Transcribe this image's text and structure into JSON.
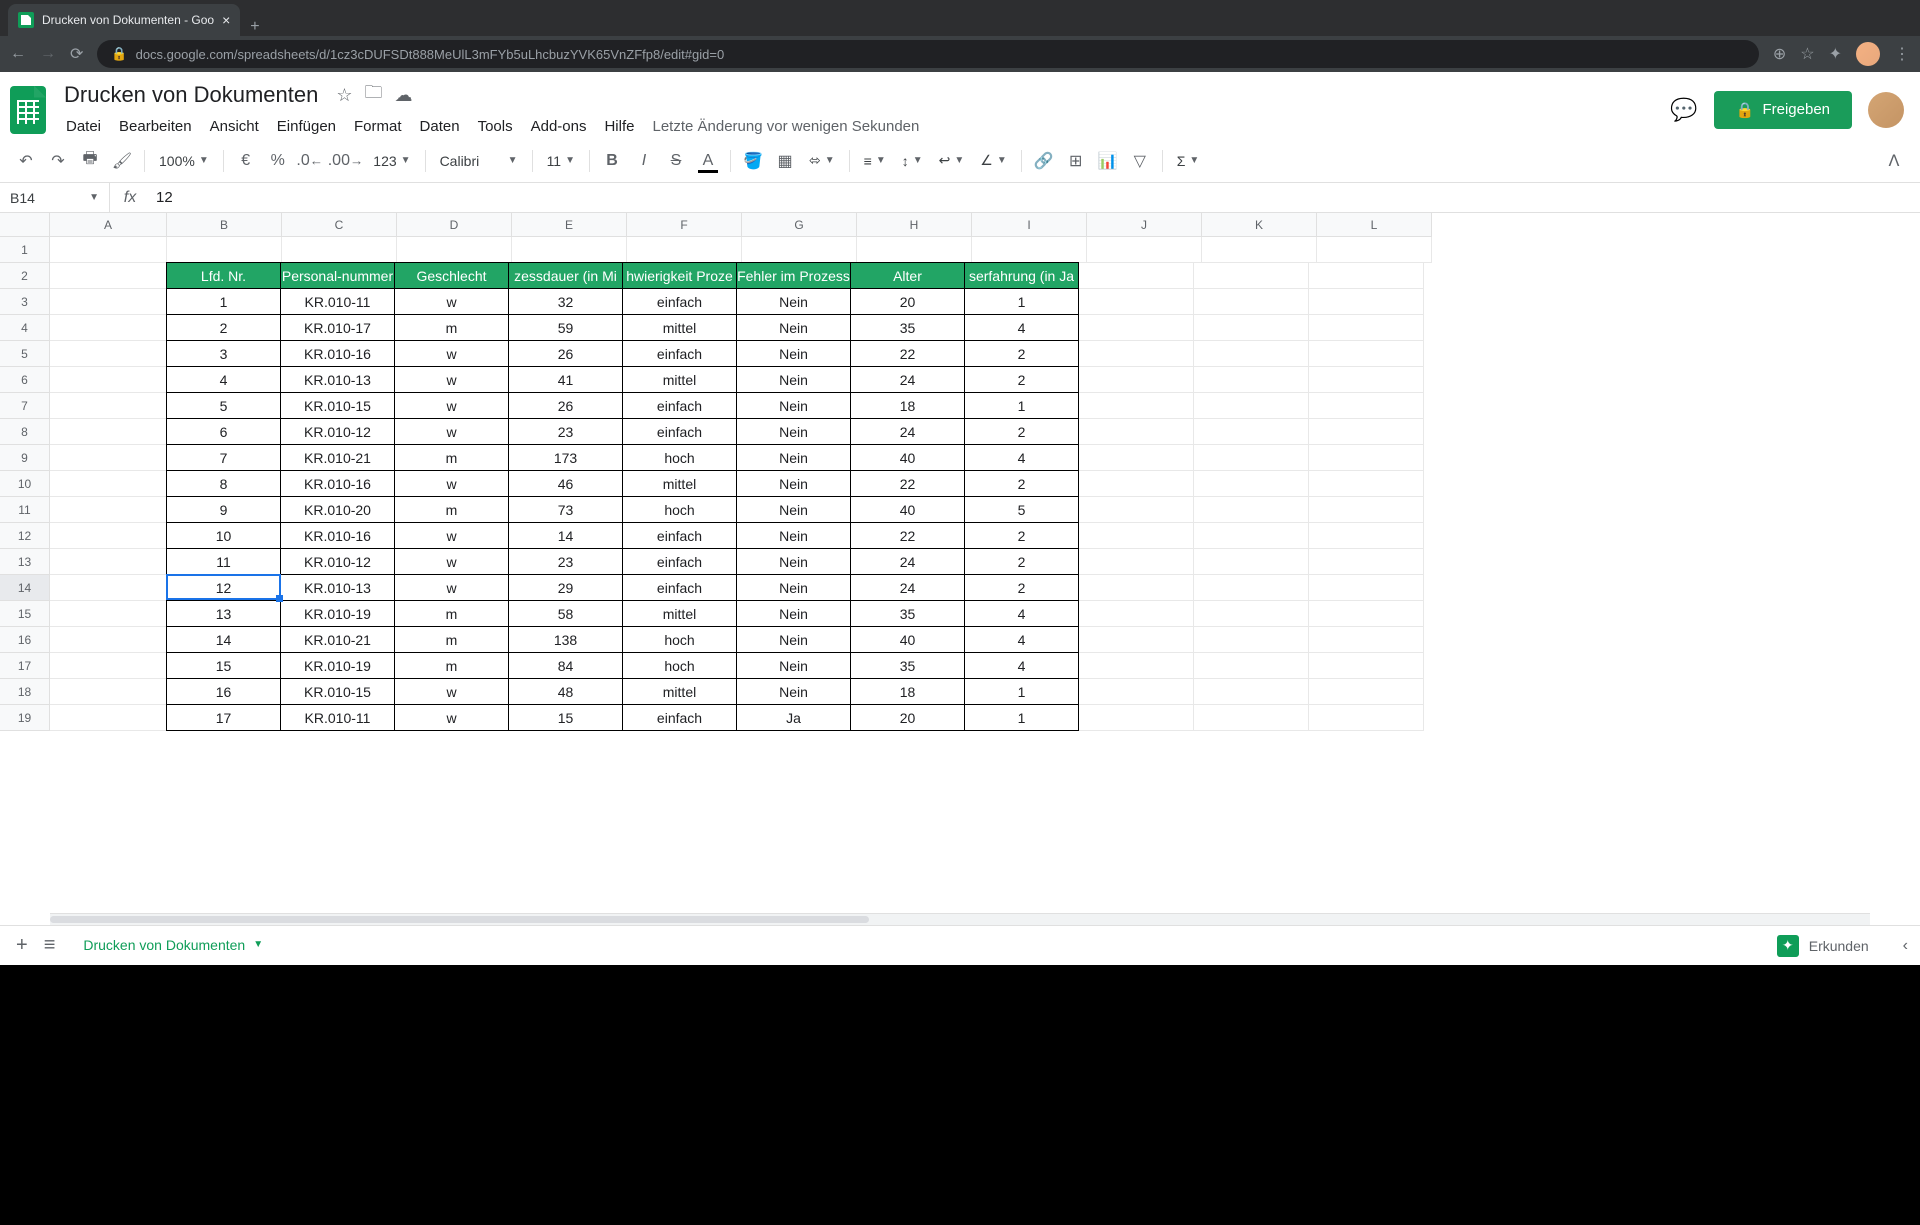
{
  "browser": {
    "tab_title": "Drucken von Dokumenten - Goo",
    "url": "docs.google.com/spreadsheets/d/1cz3cDUFSDt888MeUlL3mFYb5uLhcbuzYVK65VnZFfp8/edit#gid=0"
  },
  "doc": {
    "title": "Drucken von Dokumenten",
    "last_edit": "Letzte Änderung vor wenigen Sekunden",
    "share_label": "Freigeben"
  },
  "menus": [
    "Datei",
    "Bearbeiten",
    "Ansicht",
    "Einfügen",
    "Format",
    "Daten",
    "Tools",
    "Add-ons",
    "Hilfe"
  ],
  "toolbar": {
    "zoom": "100%",
    "currency": "€",
    "percent": "%",
    "dec_minus": ".0",
    "dec_plus": ".00",
    "num_format": "123",
    "font": "Calibri",
    "font_size": "11"
  },
  "formula": {
    "cell_ref": "B14",
    "value": "12"
  },
  "columns": [
    "A",
    "B",
    "C",
    "D",
    "E",
    "F",
    "G",
    "H",
    "I",
    "J",
    "K",
    "L"
  ],
  "col_widths": [
    "col-A",
    "col-B",
    "col-C",
    "col-D",
    "col-E",
    "col-F",
    "col-G",
    "col-H",
    "col-I",
    "col-J",
    "col-K",
    "col-L"
  ],
  "sheet_tab": "Drucken von Dokumenten",
  "explore_label": "Erkunden",
  "active_cell": {
    "row": 14,
    "col": "B"
  },
  "table": {
    "headers": [
      "Lfd. Nr.",
      "Personal-nummer",
      "Geschlecht",
      "zessdauer (in Mi",
      "hwierigkeit Proze",
      "Fehler im Prozess",
      "Alter",
      "serfahrung (in Ja"
    ],
    "rows": [
      [
        "1",
        "KR.010-11",
        "w",
        "32",
        "einfach",
        "Nein",
        "20",
        "1"
      ],
      [
        "2",
        "KR.010-17",
        "m",
        "59",
        "mittel",
        "Nein",
        "35",
        "4"
      ],
      [
        "3",
        "KR.010-16",
        "w",
        "26",
        "einfach",
        "Nein",
        "22",
        "2"
      ],
      [
        "4",
        "KR.010-13",
        "w",
        "41",
        "mittel",
        "Nein",
        "24",
        "2"
      ],
      [
        "5",
        "KR.010-15",
        "w",
        "26",
        "einfach",
        "Nein",
        "18",
        "1"
      ],
      [
        "6",
        "KR.010-12",
        "w",
        "23",
        "einfach",
        "Nein",
        "24",
        "2"
      ],
      [
        "7",
        "KR.010-21",
        "m",
        "173",
        "hoch",
        "Nein",
        "40",
        "4"
      ],
      [
        "8",
        "KR.010-16",
        "w",
        "46",
        "mittel",
        "Nein",
        "22",
        "2"
      ],
      [
        "9",
        "KR.010-20",
        "m",
        "73",
        "hoch",
        "Nein",
        "40",
        "5"
      ],
      [
        "10",
        "KR.010-16",
        "w",
        "14",
        "einfach",
        "Nein",
        "22",
        "2"
      ],
      [
        "11",
        "KR.010-12",
        "w",
        "23",
        "einfach",
        "Nein",
        "24",
        "2"
      ],
      [
        "12",
        "KR.010-13",
        "w",
        "29",
        "einfach",
        "Nein",
        "24",
        "2"
      ],
      [
        "13",
        "KR.010-19",
        "m",
        "58",
        "mittel",
        "Nein",
        "35",
        "4"
      ],
      [
        "14",
        "KR.010-21",
        "m",
        "138",
        "hoch",
        "Nein",
        "40",
        "4"
      ],
      [
        "15",
        "KR.010-19",
        "m",
        "84",
        "hoch",
        "Nein",
        "35",
        "4"
      ],
      [
        "16",
        "KR.010-15",
        "w",
        "48",
        "mittel",
        "Nein",
        "18",
        "1"
      ],
      [
        "17",
        "KR.010-11",
        "w",
        "15",
        "einfach",
        "Ja",
        "20",
        "1"
      ]
    ]
  },
  "chart_data": {
    "type": "table",
    "title": "Drucken von Dokumenten",
    "columns": [
      "Lfd. Nr.",
      "Personal-nummer",
      "Geschlecht",
      "Prozessdauer (in Min)",
      "Schwierigkeit Prozess",
      "Fehler im Prozess",
      "Alter",
      "Berufserfahrung (in Jahren)"
    ],
    "rows": [
      [
        1,
        "KR.010-11",
        "w",
        32,
        "einfach",
        "Nein",
        20,
        1
      ],
      [
        2,
        "KR.010-17",
        "m",
        59,
        "mittel",
        "Nein",
        35,
        4
      ],
      [
        3,
        "KR.010-16",
        "w",
        26,
        "einfach",
        "Nein",
        22,
        2
      ],
      [
        4,
        "KR.010-13",
        "w",
        41,
        "mittel",
        "Nein",
        24,
        2
      ],
      [
        5,
        "KR.010-15",
        "w",
        26,
        "einfach",
        "Nein",
        18,
        1
      ],
      [
        6,
        "KR.010-12",
        "w",
        23,
        "einfach",
        "Nein",
        24,
        2
      ],
      [
        7,
        "KR.010-21",
        "m",
        173,
        "hoch",
        "Nein",
        40,
        4
      ],
      [
        8,
        "KR.010-16",
        "w",
        46,
        "mittel",
        "Nein",
        22,
        2
      ],
      [
        9,
        "KR.010-20",
        "m",
        73,
        "hoch",
        "Nein",
        40,
        5
      ],
      [
        10,
        "KR.010-16",
        "w",
        14,
        "einfach",
        "Nein",
        22,
        2
      ],
      [
        11,
        "KR.010-12",
        "w",
        23,
        "einfach",
        "Nein",
        24,
        2
      ],
      [
        12,
        "KR.010-13",
        "w",
        29,
        "einfach",
        "Nein",
        24,
        2
      ],
      [
        13,
        "KR.010-19",
        "m",
        58,
        "mittel",
        "Nein",
        35,
        4
      ],
      [
        14,
        "KR.010-21",
        "m",
        138,
        "hoch",
        "Nein",
        40,
        4
      ],
      [
        15,
        "KR.010-19",
        "m",
        84,
        "hoch",
        "Nein",
        35,
        4
      ],
      [
        16,
        "KR.010-15",
        "w",
        48,
        "mittel",
        "Nein",
        18,
        1
      ],
      [
        17,
        "KR.010-11",
        "w",
        15,
        "einfach",
        "Ja",
        20,
        1
      ]
    ]
  }
}
